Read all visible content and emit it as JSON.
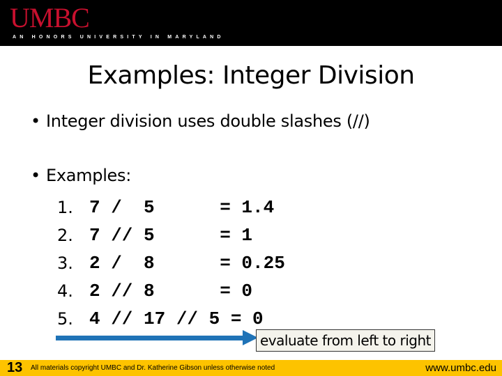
{
  "header": {
    "logo": "UMBC",
    "tagline": "AN HONORS UNIVERSITY IN MARYLAND"
  },
  "slide": {
    "title": "Examples: Integer Division",
    "bullets": [
      "Integer division uses double slashes (//)",
      "Examples:"
    ],
    "bullet_glyph": "•",
    "examples": [
      {
        "num": "1.",
        "code": "7 /  5      = 1.4"
      },
      {
        "num": "2.",
        "code": "7 // 5      = 1"
      },
      {
        "num": "3.",
        "code": "2 /  8      = 0.25"
      },
      {
        "num": "4.",
        "code": "2 // 8      = 0"
      },
      {
        "num": "5.",
        "code": "4 // 17 // 5 = 0"
      }
    ],
    "note": "evaluate from left to right",
    "arrow_color": "#1f73b7"
  },
  "footer": {
    "page_number": "13",
    "copyright": "All materials copyright UMBC and Dr. Katherine Gibson unless otherwise noted",
    "site": "www.umbc.edu",
    "bar_color": "#fdc300"
  }
}
